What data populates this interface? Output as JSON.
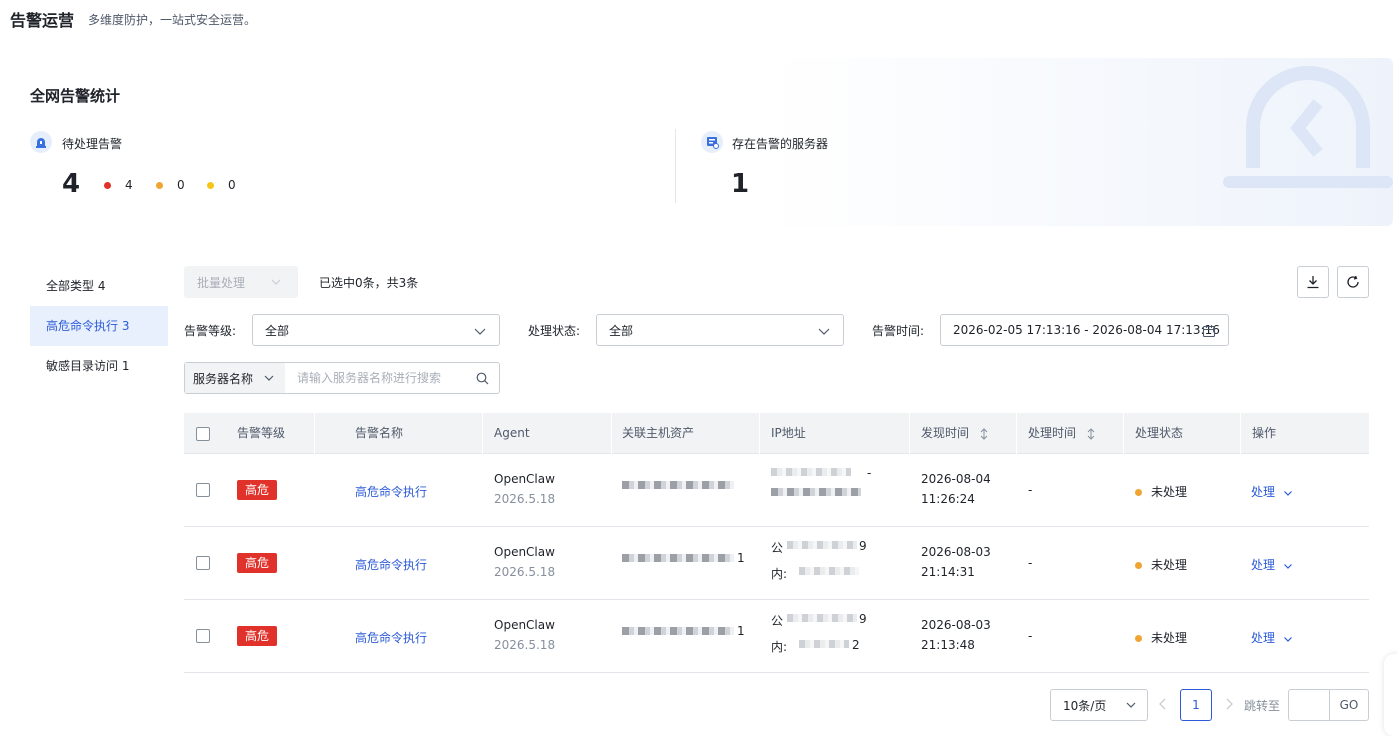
{
  "header": {
    "title": "告警运营",
    "subtitle": "多维度防护，一站式安全运营。"
  },
  "stats": {
    "title": "全网告警统计",
    "pending": {
      "label": "待处理告警",
      "total": "4",
      "levels": [
        {
          "value": "4",
          "color": "#e0322b"
        },
        {
          "value": "0",
          "color": "#f0a431"
        },
        {
          "value": "0",
          "color": "#f5c518"
        }
      ]
    },
    "servers": {
      "label": "存在告警的服务器",
      "total": "1"
    }
  },
  "sidebar": {
    "items": [
      {
        "label": "全部类型 4",
        "active": false
      },
      {
        "label": "高危命令执行 3",
        "active": true
      },
      {
        "label": "敏感目录访问 1",
        "active": false
      }
    ]
  },
  "toolbar": {
    "batch_label": "批量处理",
    "selection_text": "已选中0条，共3条",
    "download_icon": "download-icon",
    "refresh_icon": "refresh-icon"
  },
  "filters": {
    "level_label": "告警等级:",
    "level_value": "全部",
    "status_label": "处理状态:",
    "status_value": "全部",
    "time_label": "告警时间:",
    "time_value": "2026-02-05 17:13:16 - 2026-08-04 17:13:16",
    "search_type": "服务器名称",
    "search_placeholder": "请输入服务器名称进行搜索"
  },
  "table": {
    "columns": [
      "告警等级",
      "告警名称",
      "Agent",
      "关联主机资产",
      "IP地址",
      "发现时间",
      "处理时间",
      "处理状态",
      "操作"
    ],
    "rows": [
      {
        "level": "高危",
        "name": "高危命令执行",
        "agent": "OpenClaw",
        "agent_version": "2026.5.18",
        "ip_line1_prefix": "",
        "ip_line1_suffix": "-",
        "ip_line2_prefix": "",
        "ip_line2_suffix": "",
        "asset_suffix": "",
        "found_date": "2026-08-04",
        "found_time": "11:26:24",
        "handled": "-",
        "status": "未处理",
        "action": "处理"
      },
      {
        "level": "高危",
        "name": "高危命令执行",
        "agent": "OpenClaw",
        "agent_version": "2026.5.18",
        "ip_line1_prefix": "公",
        "ip_line1_suffix": "9",
        "ip_line2_prefix": "内:",
        "ip_line2_suffix": "",
        "asset_suffix": "1",
        "found_date": "2026-08-03",
        "found_time": "21:14:31",
        "handled": "-",
        "status": "未处理",
        "action": "处理"
      },
      {
        "level": "高危",
        "name": "高危命令执行",
        "agent": "OpenClaw",
        "agent_version": "2026.5.18",
        "ip_line1_prefix": "公",
        "ip_line1_suffix": "9",
        "ip_line2_prefix": "内:",
        "ip_line2_suffix": "2",
        "asset_suffix": "1",
        "found_date": "2026-08-03",
        "found_time": "21:13:48",
        "handled": "-",
        "status": "未处理",
        "action": "处理"
      }
    ]
  },
  "pagination": {
    "page_size": "10条/页",
    "current_page": "1",
    "jump_label": "跳转至",
    "go_label": "GO"
  },
  "colors": {
    "accent": "#2d5bd7",
    "danger": "#e0322b",
    "warning": "#f0a431"
  }
}
